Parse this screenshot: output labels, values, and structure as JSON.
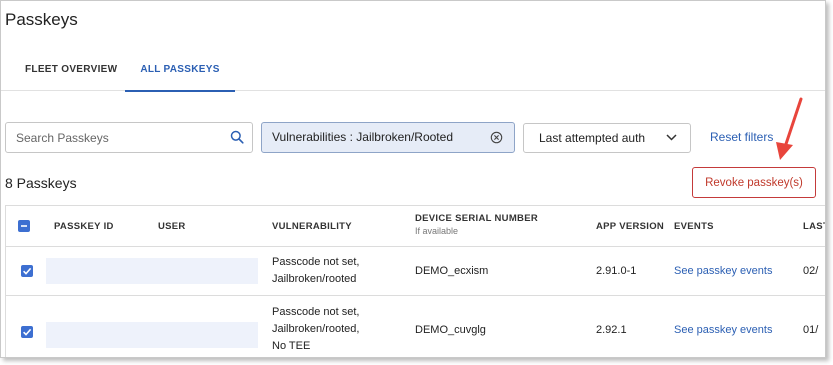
{
  "page": {
    "title": "Passkeys"
  },
  "tabs": [
    {
      "label": "FLEET OVERVIEW"
    },
    {
      "label": "ALL PASSKEYS"
    }
  ],
  "filters": {
    "search_placeholder": "Search Passkeys",
    "chip_label": "Vulnerabilities : Jailbroken/Rooted",
    "dropdown_value": "Last attempted auth",
    "reset_label": "Reset filters"
  },
  "summary": {
    "count_text": "8 Passkeys"
  },
  "actions": {
    "revoke_label": "Revoke passkey(s)"
  },
  "table": {
    "columns": {
      "passkey_id": "PASSKEY ID",
      "user": "USER",
      "vulnerability": "VULNERABILITY",
      "device_serial": "DEVICE SERIAL NUMBER",
      "device_serial_sub": "If available",
      "app_version": "APP VERSION",
      "events": "EVENTS",
      "last": "LAST"
    },
    "rows": [
      {
        "vulnerability": [
          "Passcode not set,",
          "Jailbroken/rooted"
        ],
        "serial": "DEMO_ecxism",
        "app_version": "2.91.0-1",
        "events_link": "See passkey events",
        "last": "02/"
      },
      {
        "vulnerability": [
          "Passcode not set,",
          "Jailbroken/rooted,",
          "No TEE"
        ],
        "serial": "DEMO_cuvglg",
        "app_version": "2.92.1",
        "events_link": "See passkey events",
        "last": "01/"
      }
    ]
  },
  "colors": {
    "accent": "#2b5fb3",
    "checkbox": "#3d6fd1",
    "danger": "#c0392b",
    "annotation_arrow": "#e8453c",
    "chip_bg": "#e6ecf7"
  }
}
